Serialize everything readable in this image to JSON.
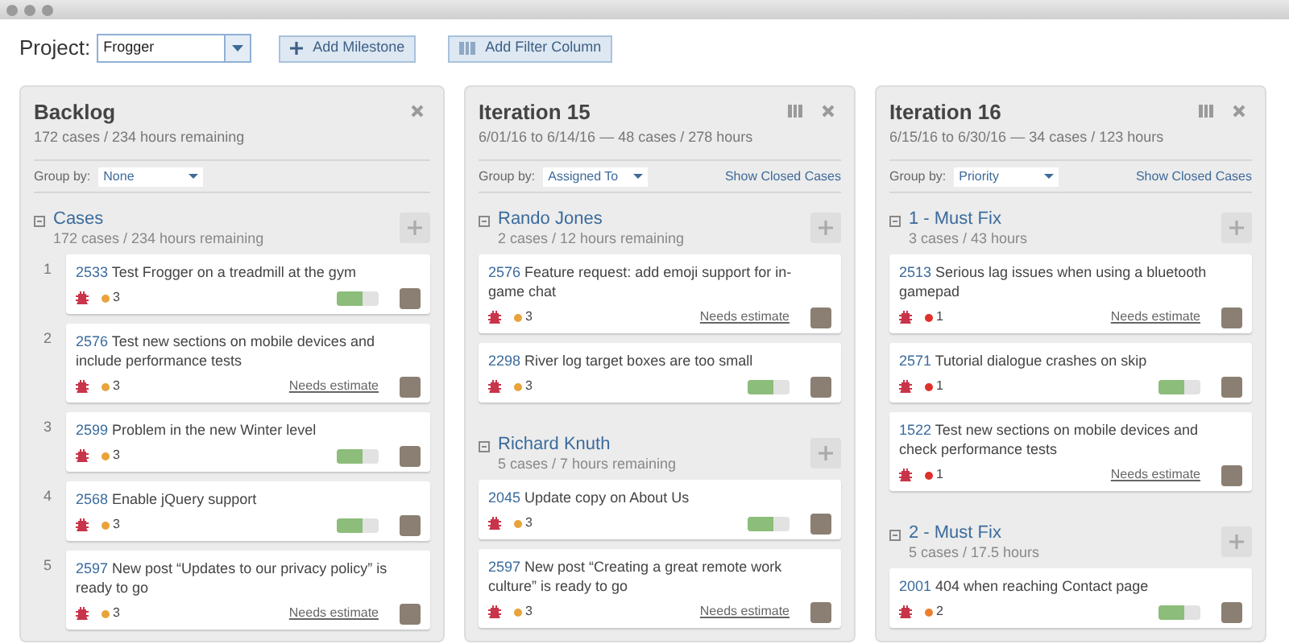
{
  "project": {
    "label": "Project:",
    "value": "Frogger"
  },
  "toolbar_buttons": [
    {
      "kind": "milestone",
      "label": "Add Milestone"
    },
    {
      "kind": "filter",
      "label": "Add Filter Column"
    }
  ],
  "columns": [
    {
      "title": "Backlog",
      "subtitle": "172 cases / 234 hours remaining",
      "group_by_label": "Group by:",
      "group_by": "None",
      "groups": [
        {
          "name": "Cases",
          "summary": "172 cases / 234 hours remaining",
          "cards": [
            {
              "number": "1",
              "id": "2533",
              "title": "Test Frogger on a treadmill at the gym",
              "priority": "3",
              "color": "#e8a33a",
              "level": 0.62
            },
            {
              "number": "2",
              "id": "2576",
              "title": "Test new sections on mobile devices and include performance tests",
              "priority": "3",
              "color": "#e8a33a",
              "estimate": "Needs estimate"
            },
            {
              "number": "3",
              "id": "2599",
              "title": "Problem in the new Winter level",
              "priority": "3",
              "color": "#e8a33a",
              "level": 0.62
            },
            {
              "number": "4",
              "id": "2568",
              "title": "Enable jQuery support",
              "priority": "3",
              "color": "#e8a33a",
              "level": 0.62
            },
            {
              "number": "5",
              "id": "2597",
              "title": "New post “Updates to our privacy policy” is ready to go",
              "priority": "3",
              "color": "#e8a33a",
              "estimate": "Needs estimate"
            }
          ]
        }
      ]
    },
    {
      "title": "Iteration 15",
      "subtitle": "6/01/16 to 6/14/16 — 48 cases / 278 hours",
      "columns_icon": true,
      "group_by_label": "Group by:",
      "group_by": "Assigned To",
      "show_closed": "Show Closed Cases",
      "groups": [
        {
          "name": "Rando Jones",
          "summary": "2 cases / 12 hours remaining",
          "cards": [
            {
              "id": "2576",
              "title": "Feature request: add emoji support for in-game chat",
              "priority": "3",
              "color": "#e8a33a",
              "estimate": "Needs estimate"
            },
            {
              "id": "2298",
              "title": "River log target boxes are too small",
              "priority": "3",
              "color": "#e8a33a",
              "level": 0.62
            }
          ]
        },
        {
          "name": "Richard Knuth",
          "summary": "5 cases / 7 hours remaining",
          "cards": [
            {
              "id": "2045",
              "title": "Update copy on About Us",
              "priority": "3",
              "color": "#e8a33a",
              "level": 0.62
            },
            {
              "id": "2597",
              "title": "New post “Creating a great remote work culture” is ready to go",
              "priority": "3",
              "color": "#e8a33a",
              "estimate": "Needs estimate"
            }
          ]
        }
      ]
    },
    {
      "title": "Iteration 16",
      "subtitle": "6/15/16 to 6/30/16 — 34 cases / 123 hours",
      "columns_icon": true,
      "group_by_label": "Group by:",
      "group_by": "Priority",
      "show_closed": "Show Closed Cases",
      "groups": [
        {
          "name": "1 - Must Fix",
          "summary": "3 cases / 43 hours",
          "cards": [
            {
              "id": "2513",
              "title": "Serious lag issues when using a bluetooth gamepad",
              "priority": "1",
              "color": "#e0302a",
              "estimate": "Needs estimate"
            },
            {
              "id": "2571",
              "title": "Tutorial dialogue crashes on skip",
              "priority": "1",
              "color": "#e0302a",
              "level": 0.62
            },
            {
              "id": "1522",
              "title": "Test new sections on mobile devices and check performance tests",
              "priority": "1",
              "color": "#e0302a",
              "estimate": "Needs estimate"
            }
          ]
        },
        {
          "name": "2 - Must Fix",
          "summary": "5 cases / 17.5 hours",
          "cards": [
            {
              "id": "2001",
              "title": "404 when reaching Contact page",
              "priority": "2",
              "color": "#ec7f2c",
              "level": 0.62
            }
          ]
        }
      ]
    }
  ]
}
